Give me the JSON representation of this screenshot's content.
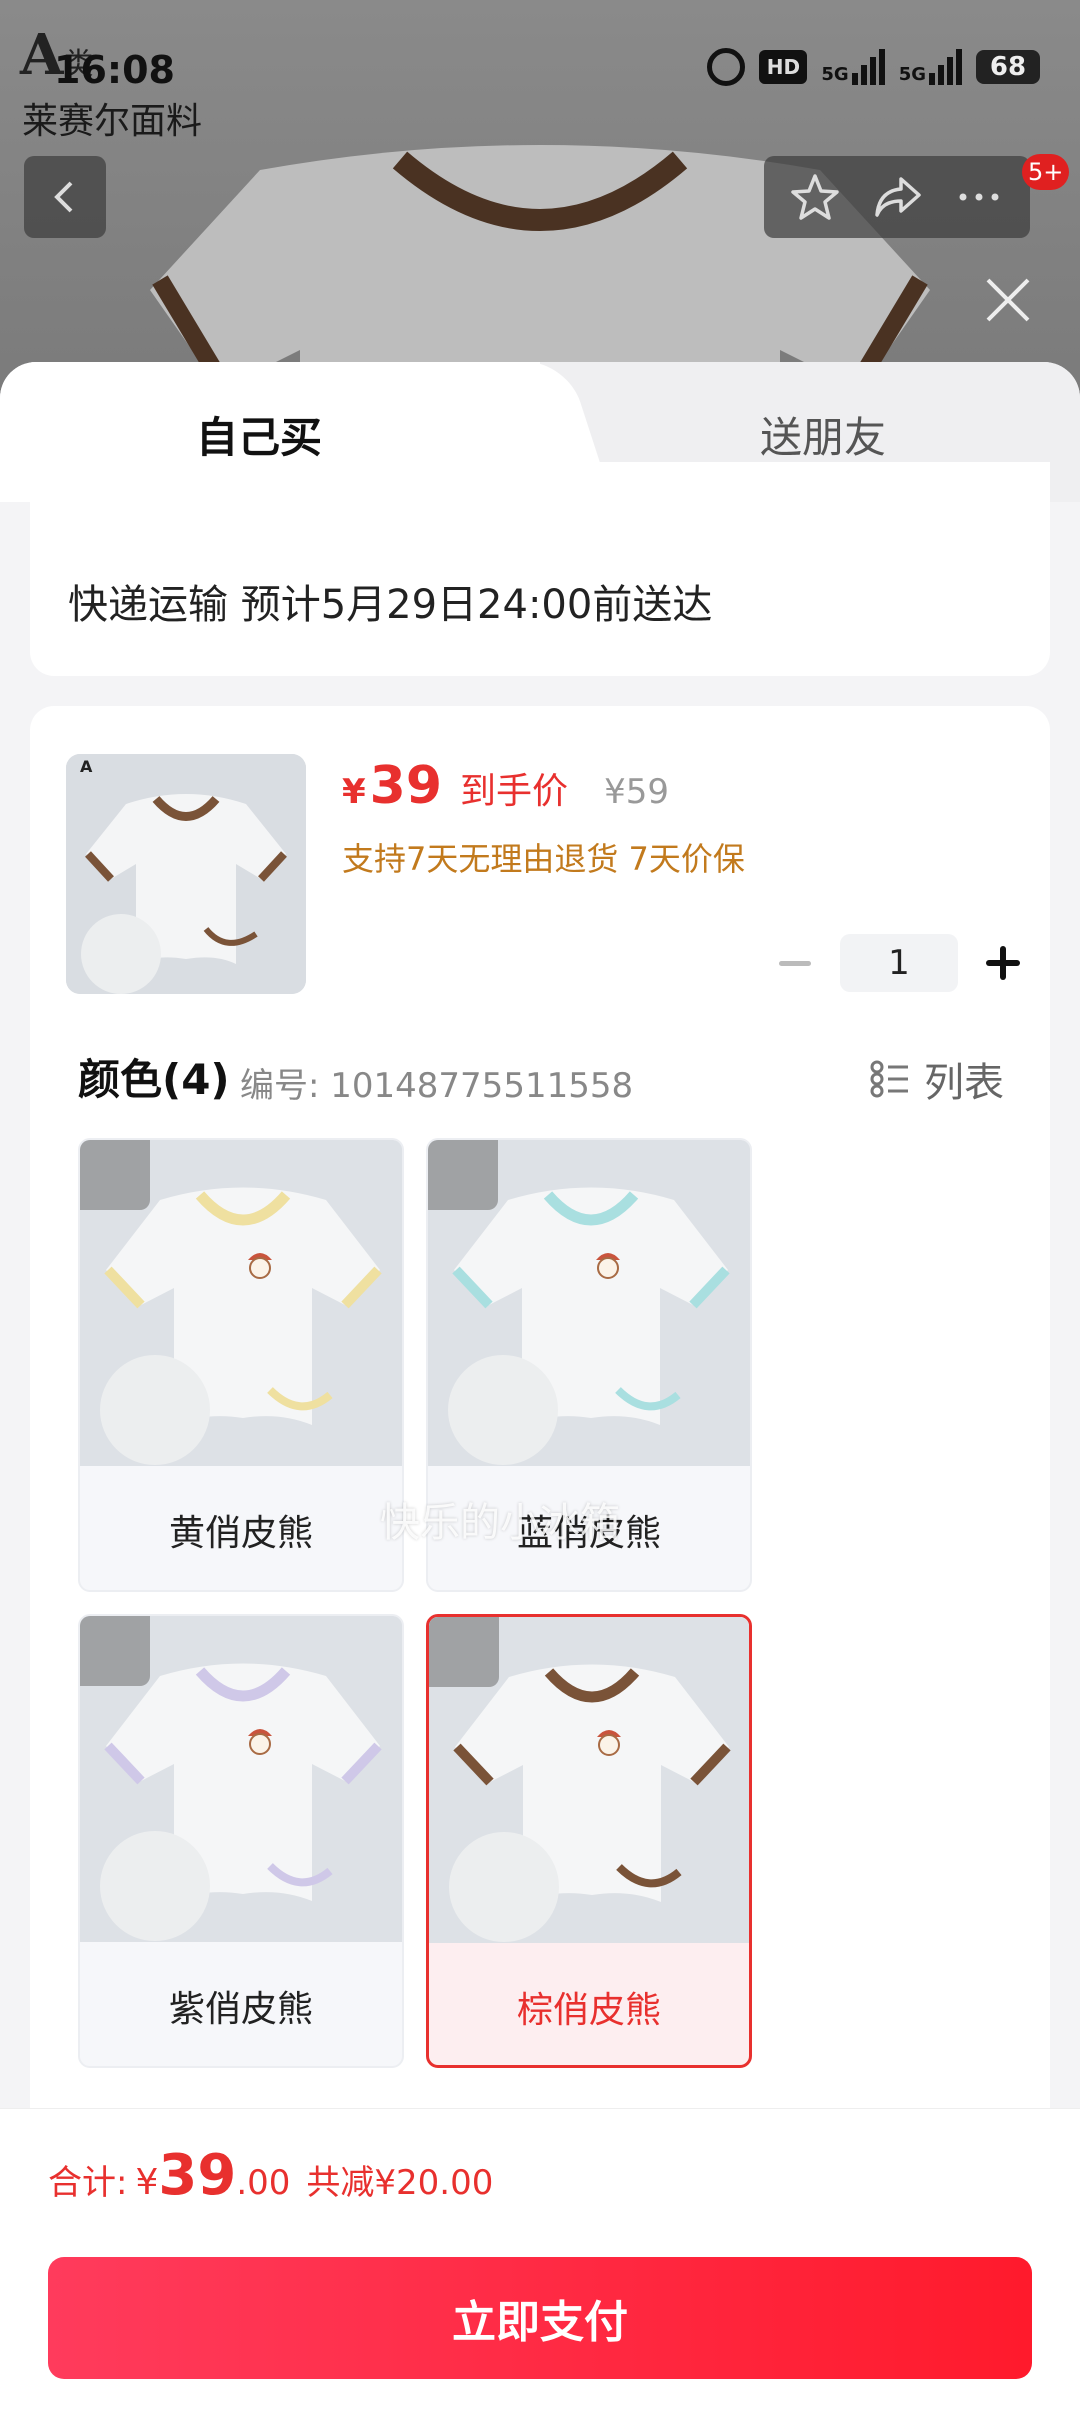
{
  "status_bar": {
    "time": "16:08",
    "battery": "68",
    "network1": "5G",
    "network2": "5G",
    "hd": "HD"
  },
  "brand": {
    "logo_letter": "A",
    "logo_suffix": "类",
    "name": "莱赛尔面料"
  },
  "header": {
    "badge": "5+"
  },
  "tabs": {
    "self": "自己买",
    "gift": "送朋友"
  },
  "delivery": {
    "text": "快递运输 预计5月29日24:00前送达"
  },
  "product": {
    "currency": "¥",
    "price": "39",
    "price_label": "到手价",
    "original_price": "¥59",
    "guarantee": "支持7天无理由退货 7天价保",
    "quantity": "1"
  },
  "color_section": {
    "title": "颜色(4)",
    "sku": "编号: 10148775511558",
    "list_label": "列表"
  },
  "options": [
    {
      "label": "黄俏皮熊",
      "trim": "#efe0a0",
      "selected": false
    },
    {
      "label": "蓝俏皮熊",
      "trim": "#a9dfe0",
      "selected": false
    },
    {
      "label": "紫俏皮熊",
      "trim": "#cfc8e8",
      "selected": false
    },
    {
      "label": "棕俏皮熊",
      "trim": "#7a5338",
      "selected": true
    }
  ],
  "watermark": "快乐的小冰箱",
  "footer": {
    "total_label": "合计:",
    "currency": "¥",
    "total_int": "39",
    "total_dec": ".00",
    "savings": "共减¥20.00",
    "pay_button": "立即支付"
  },
  "colors": {
    "accent": "#e8302e",
    "guarantee": "#c27a1d",
    "pay_start": "#ff3b5c",
    "pay_end": "#ff1a2c"
  }
}
